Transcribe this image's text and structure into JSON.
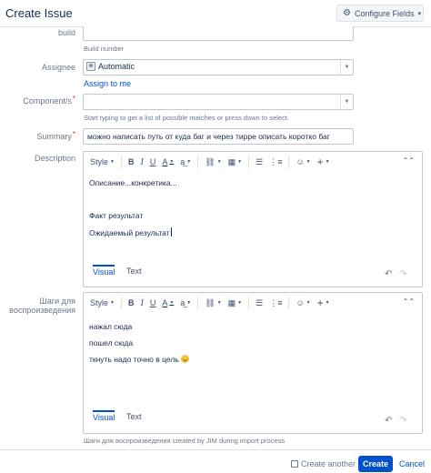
{
  "dialog": {
    "title": "Create Issue",
    "configure_label": "Configure Fields",
    "configure_dropdown": "▾"
  },
  "fields": {
    "build": {
      "label": "build",
      "value": "",
      "hint": "Build number"
    },
    "assignee": {
      "label": "Assignee",
      "value": "Automatic",
      "assign_to_me": "Assign to me"
    },
    "components": {
      "label": "Component/s",
      "required_mark": "*",
      "value": "",
      "hint": "Start typing to get a list of possible matches or press down to select."
    },
    "summary": {
      "label": "Summary",
      "required_mark": "*",
      "value": "можно написать путь от куда баг и через тирре описать коротко баг"
    }
  },
  "toolbar": {
    "style_label": "Style",
    "bold": "B",
    "italic": "I",
    "underline": "U",
    "text_color": "A",
    "more_format": "a͢",
    "link": "⛓",
    "table": "▦",
    "bullet_list": "☰",
    "numbered_list": "⋮≡",
    "emoji": "☺",
    "insert": "+",
    "collapse": "⌃"
  },
  "description": {
    "label": "Description",
    "lines": [
      "Описание...конкретика...",
      "Факт результат",
      "Ожидаемый результат"
    ],
    "tab_visual": "Visual",
    "tab_text": "Text"
  },
  "steps": {
    "label_line1": "Шаги для",
    "label_line2": "воспроизведения",
    "lines": [
      "нажал сюда",
      "пошел сюда",
      "ткнуть надо точно в цель"
    ],
    "tab_visual": "Visual",
    "tab_text": "Text",
    "hint": "Шаги для воспроизведения created by JIM during import process"
  },
  "footer": {
    "create_another": "Create another",
    "create": "Create",
    "cancel": "Cancel"
  },
  "colors": {
    "accent": "#0052cc",
    "required": "#de350b",
    "muted": "#6b778c"
  }
}
